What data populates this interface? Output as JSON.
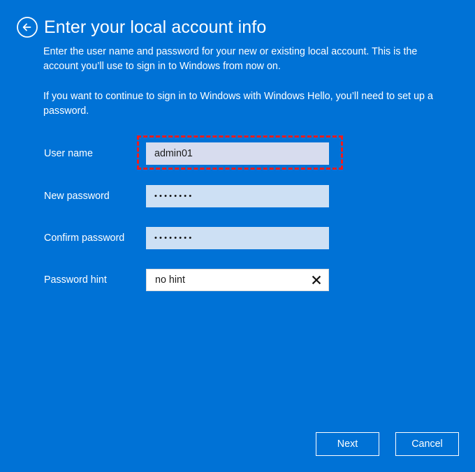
{
  "page": {
    "title": "Enter your local account info",
    "background_color": "#0072d6",
    "paragraph_1": "Enter the user name and password for your new or existing local account. This is the account you’ll use to sign in to Windows from now on.",
    "paragraph_2": "If you want to continue to sign in to Windows with Windows Hello, you’ll need to set up a password."
  },
  "nav": {
    "back_icon": "back-arrow-circle-icon"
  },
  "form": {
    "fields": [
      {
        "label": "User name",
        "value": "admin01",
        "placeholder": "",
        "state": "highlighted",
        "has_clear": false
      },
      {
        "label": "New password",
        "value": "••••••••",
        "placeholder": "",
        "state": "filled",
        "has_clear": false
      },
      {
        "label": "Confirm password",
        "value": "••••••••",
        "placeholder": "",
        "state": "filled",
        "has_clear": false
      },
      {
        "label": "Password hint",
        "value": "no hint",
        "placeholder": "",
        "state": "focused",
        "has_clear": true,
        "clear_icon": "close-x-icon"
      }
    ]
  },
  "highlight": {
    "target": "User name",
    "color": "#f01c1c",
    "style": "dashed"
  },
  "footer": {
    "next_label": "Next",
    "cancel_label": "Cancel"
  }
}
